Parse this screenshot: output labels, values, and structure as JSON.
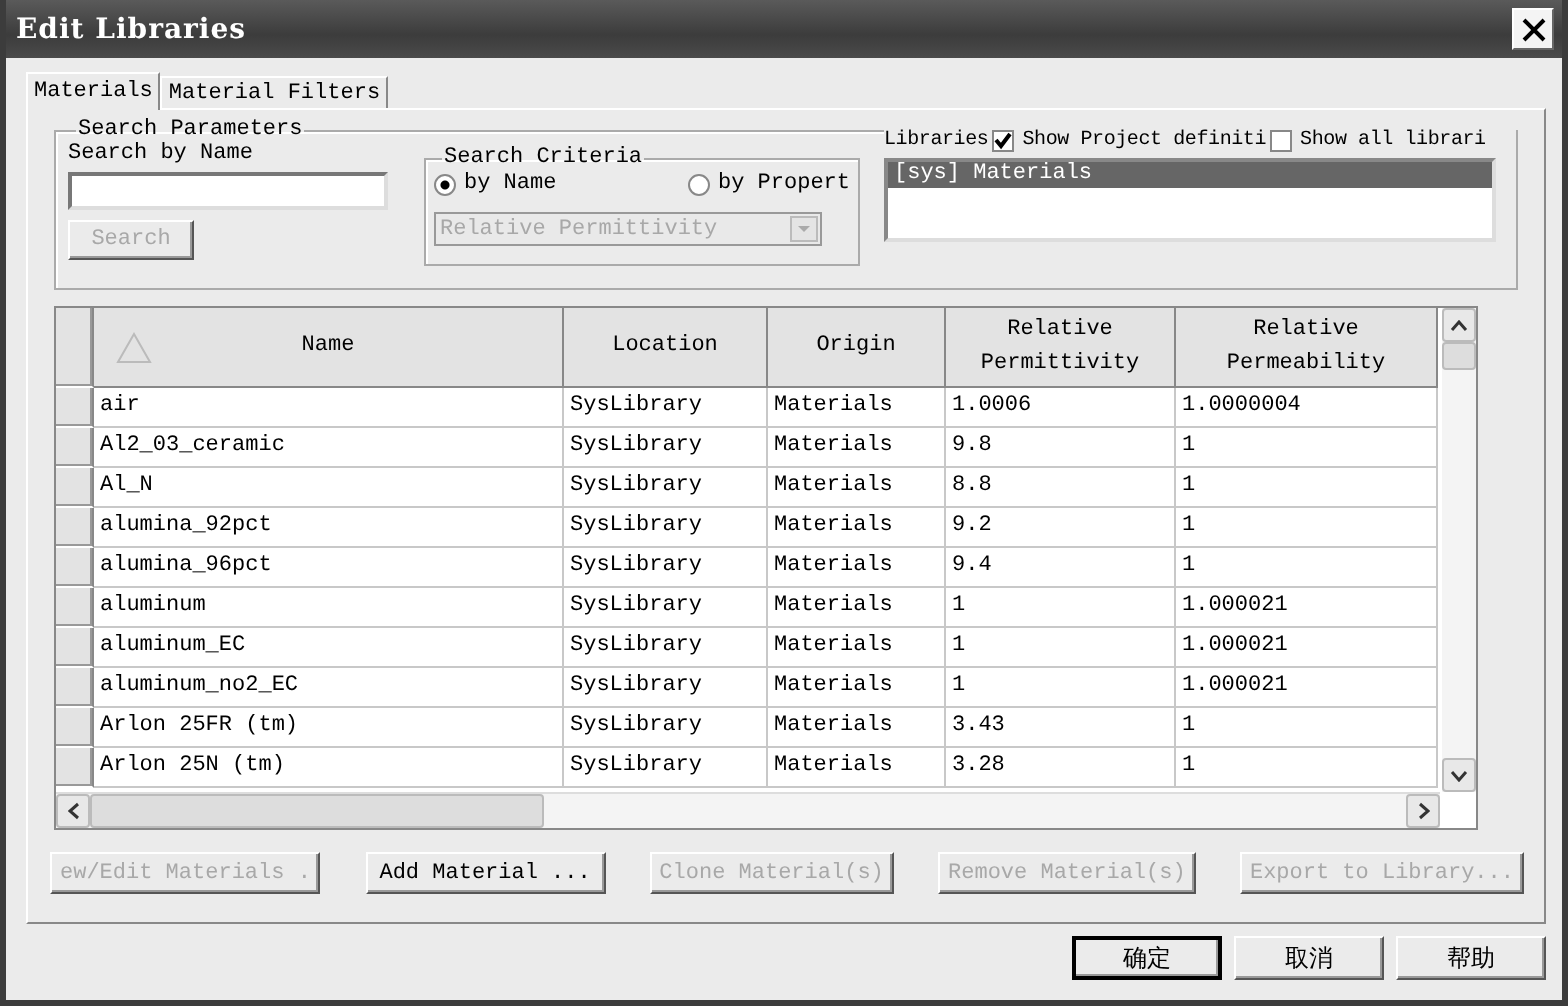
{
  "window": {
    "title": "Edit Libraries"
  },
  "tabs": [
    {
      "label": "Materials",
      "selected": true
    },
    {
      "label": "Material Filters",
      "selected": false
    }
  ],
  "search_parameters": {
    "title": "Search Parameters",
    "name_label": "Search by Name",
    "search_button": {
      "label": "Search",
      "disabled": true
    }
  },
  "search_criteria": {
    "title": "Search Criteria",
    "options": [
      {
        "label": "by Name",
        "selected": true
      },
      {
        "label": "by Propert",
        "selected": false
      }
    ],
    "property_dropdown": {
      "value": "Relative Permittivity",
      "disabled": true
    }
  },
  "libraries": {
    "label": "Libraries",
    "checkboxes": [
      {
        "label": "Show Project definiti",
        "checked": true
      },
      {
        "label": "Show all librari",
        "checked": false
      }
    ],
    "items": [
      {
        "label": "[sys] Materials",
        "selected": true
      }
    ]
  },
  "table": {
    "columns": [
      "Name",
      "Location",
      "Origin",
      "Relative Permittivity",
      "Relative Permeability"
    ],
    "rows": [
      [
        "air",
        "SysLibrary",
        "Materials",
        "1.0006",
        "1.0000004"
      ],
      [
        "Al2_03_ceramic",
        "SysLibrary",
        "Materials",
        "9.8",
        "1"
      ],
      [
        "Al_N",
        "SysLibrary",
        "Materials",
        "8.8",
        "1"
      ],
      [
        "alumina_92pct",
        "SysLibrary",
        "Materials",
        "9.2",
        "1"
      ],
      [
        "alumina_96pct",
        "SysLibrary",
        "Materials",
        "9.4",
        "1"
      ],
      [
        "aluminum",
        "SysLibrary",
        "Materials",
        "1",
        "1.000021"
      ],
      [
        "aluminum_EC",
        "SysLibrary",
        "Materials",
        "1",
        "1.000021"
      ],
      [
        "aluminum_no2_EC",
        "SysLibrary",
        "Materials",
        "1",
        "1.000021"
      ],
      [
        "Arlon 25FR (tm)",
        "SysLibrary",
        "Materials",
        "3.43",
        "1"
      ],
      [
        "Arlon 25N (tm)",
        "SysLibrary",
        "Materials",
        "3.28",
        "1"
      ]
    ]
  },
  "action_buttons": [
    {
      "label": "ew/Edit Materials .",
      "disabled": true
    },
    {
      "label": "Add Material ...",
      "disabled": false
    },
    {
      "label": "Clone Material(s)",
      "disabled": true
    },
    {
      "label": "Remove Material(s)",
      "disabled": true
    },
    {
      "label": "Export to Library...",
      "disabled": true
    }
  ],
  "dialog_buttons": [
    "确定",
    "取消",
    "帮助"
  ]
}
